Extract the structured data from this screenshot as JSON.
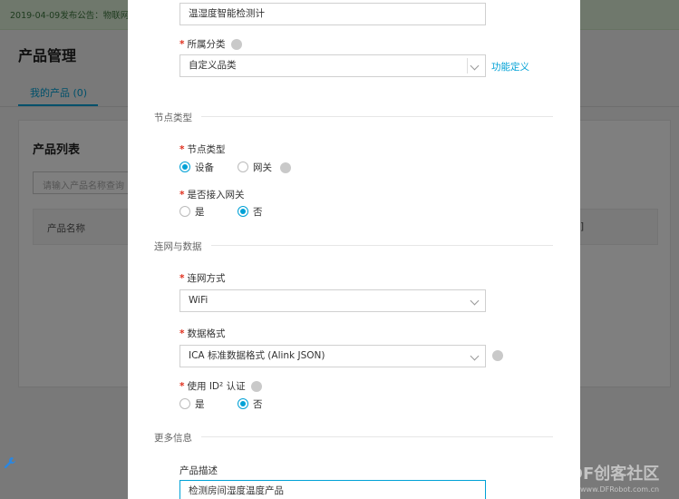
{
  "background": {
    "notice": "2019-04-09发布公告：物联网",
    "page_title": "产品管理",
    "tab_my_products": "我的产品 (0)",
    "card_title": "产品列表",
    "search_placeholder": "请输入产品名称查询",
    "col_product_name": "产品名称",
    "col_partial": "]"
  },
  "modal": {
    "product_name_value": "温湿度智能检测计",
    "category": {
      "label": "所属分类",
      "value": "自定义品类",
      "link": "功能定义"
    },
    "section_node": "节点类型",
    "node_type": {
      "label": "节点类型",
      "options": [
        "设备",
        "网关"
      ],
      "selected": "设备"
    },
    "gateway_access": {
      "label": "是否接入网关",
      "options": [
        "是",
        "否"
      ],
      "selected": "否"
    },
    "section_network": "连网与数据",
    "network_method": {
      "label": "连网方式",
      "value": "WiFi"
    },
    "data_format": {
      "label": "数据格式",
      "value": "ICA 标准数据格式 (Alink JSON)"
    },
    "id2_auth": {
      "label": "使用 ID² 认证",
      "options": [
        "是",
        "否"
      ],
      "selected": "否"
    },
    "section_more": "更多信息",
    "description": {
      "label": "产品描述",
      "value": "检测房间湿度温度产品"
    }
  },
  "watermark": {
    "text": "DF创客社区",
    "url": "www.DFRobot.com.cn"
  },
  "colors": {
    "accent": "#00a1d6",
    "required": "#e0301e",
    "notice_bg": "#dff0d8"
  }
}
